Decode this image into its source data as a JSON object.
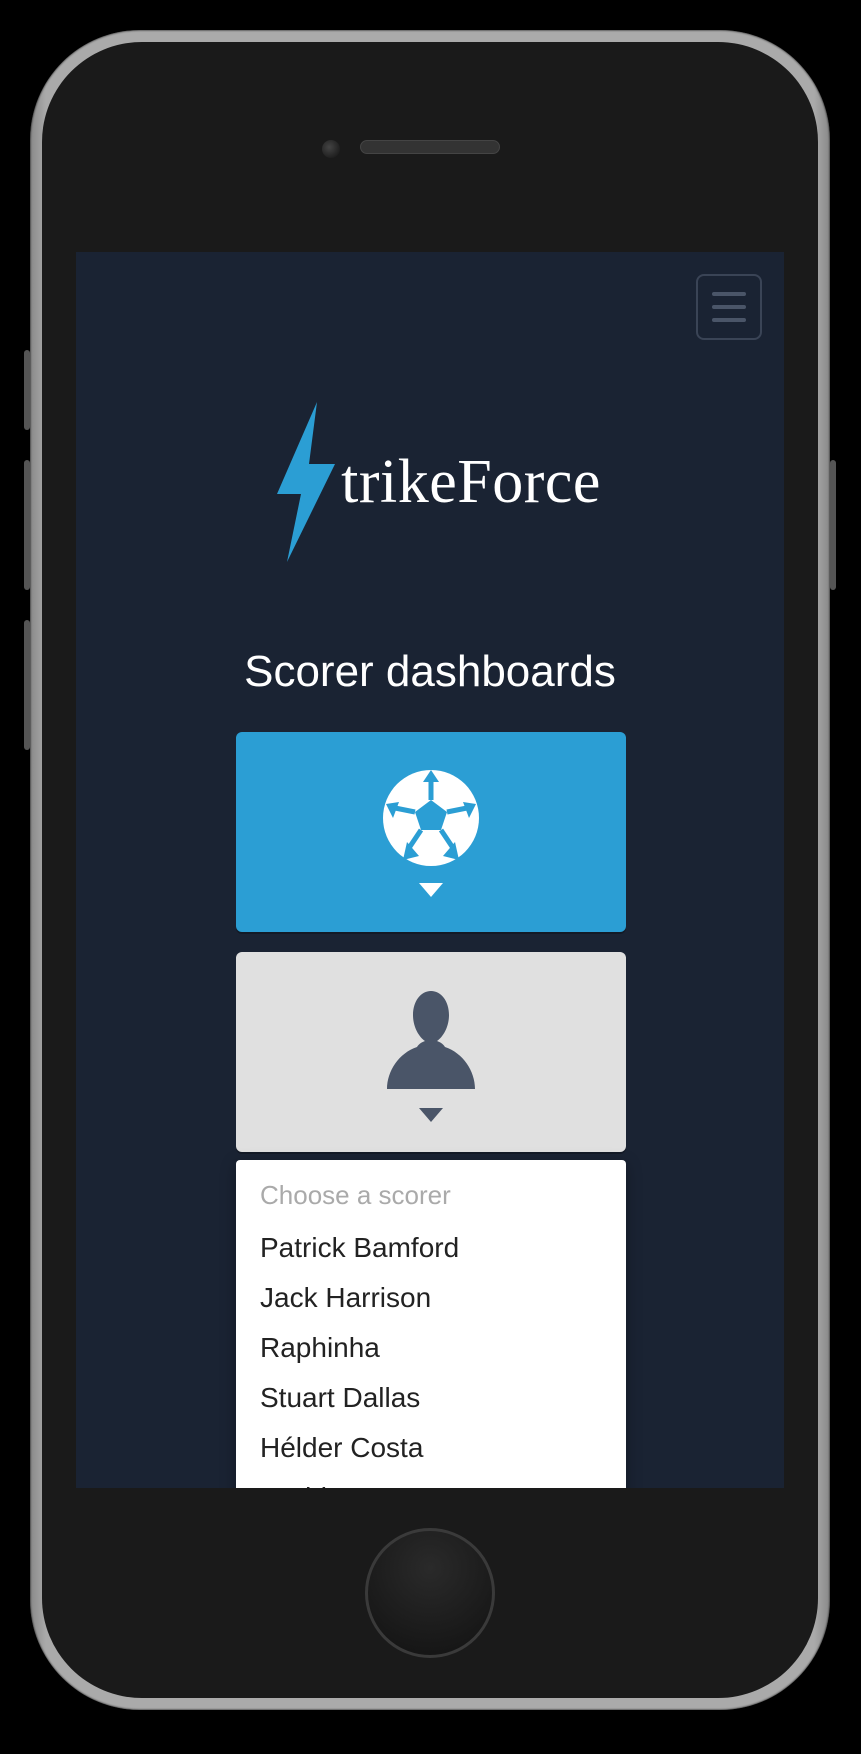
{
  "app": {
    "brand": "trikeForce",
    "section_title": "Scorer dashboards"
  },
  "colors": {
    "accent": "#2b9ed4",
    "bg": "#1a2333"
  },
  "scorer_dropdown": {
    "prompt": "Choose a scorer",
    "options": [
      "Patrick Bamford",
      "Jack Harrison",
      "Raphinha",
      "Stuart Dallas",
      "Hélder Costa",
      "Rodrigo Moreno"
    ]
  }
}
